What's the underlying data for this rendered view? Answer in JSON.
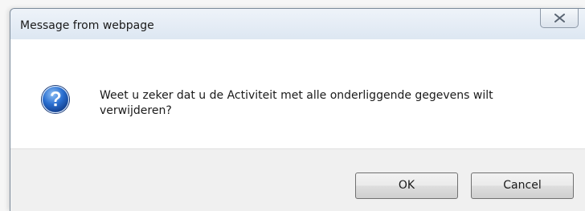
{
  "dialog": {
    "title": "Message from webpage",
    "close_label": "Close",
    "icon": "question-icon",
    "message": "Weet u zeker dat u de Activiteit met alle onderliggende gegevens wilt verwijderen?",
    "buttons": {
      "ok_label": "OK",
      "cancel_label": "Cancel"
    }
  },
  "colors": {
    "titlebar": "#dde7f2",
    "icon_blue": "#1e5bb8",
    "footer": "#f0f0f0"
  }
}
